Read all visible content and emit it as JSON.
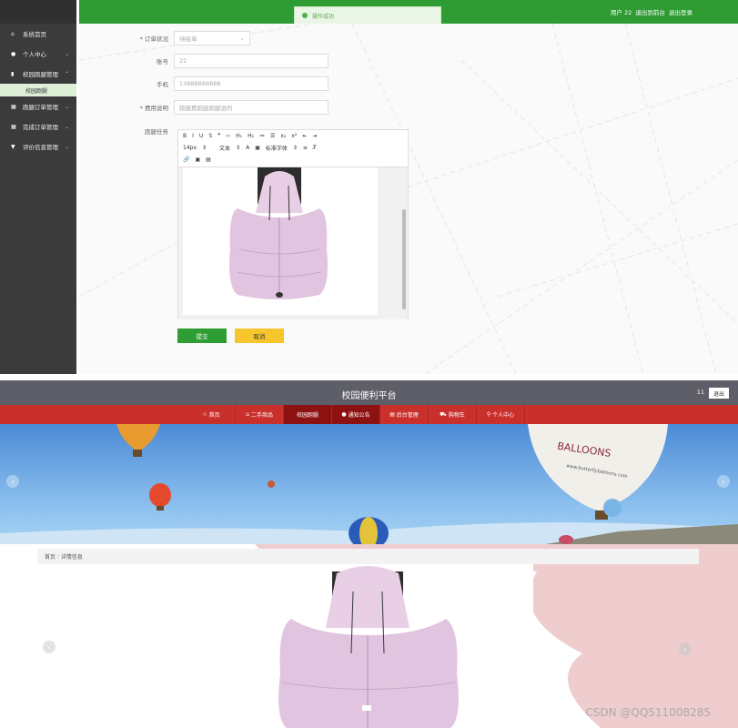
{
  "admin": {
    "sidebar": [
      {
        "icon": "home-icon",
        "label": "系统首页",
        "chevron": false
      },
      {
        "icon": "user-icon",
        "label": "个人中心",
        "chevron": true
      },
      {
        "icon": "chart-icon",
        "label": "校园跑腿管理",
        "chevron": true,
        "expanded": true
      },
      {
        "icon": "grid-icon",
        "label": "跑腿订单管理",
        "chevron": true
      },
      {
        "icon": "grid-icon",
        "label": "完成订单管理",
        "chevron": true
      },
      {
        "icon": "pin-icon",
        "label": "评价信息管理",
        "chevron": true
      }
    ],
    "sub_item": "校园跑腿",
    "header": {
      "user": "用户 22",
      "link1": "退出到前台",
      "link2": "退出登录"
    },
    "toast": "操作成功",
    "form": {
      "status_label": "* 订单状况",
      "status_value": "待接单",
      "account_label": "账号",
      "account_value": "22",
      "phone_label": "手机",
      "phone_value": "13888888888",
      "fee_label": "* 费用说明",
      "fee_value": "跑腿费跑腿跑腿说的",
      "task_label": "跑腿任务",
      "toolbar_row1": [
        "B",
        "I",
        "U",
        "S",
        "❞",
        "‹›",
        "H₁",
        "H₂",
        "≔",
        "☰",
        "x₂",
        "x²",
        "⇤",
        "⇥"
      ],
      "toolbar_row2": [
        "14px",
        "文本",
        "标准字体"
      ],
      "submit": "提交",
      "cancel": "取消"
    }
  },
  "front": {
    "title": "校园便利平台",
    "uid": "11",
    "logout": "退出",
    "nav": [
      {
        "icon": "☆",
        "label": "首页"
      },
      {
        "icon": "⌂",
        "label": "二手商品"
      },
      {
        "icon": "",
        "label": "校园跑腿",
        "active": true
      },
      {
        "icon": "●",
        "label": "通知公告",
        "active": true
      },
      {
        "icon": "▤",
        "label": "后台管理"
      },
      {
        "icon": "🛒",
        "label": "购物车"
      },
      {
        "icon": "⚲",
        "label": "个人中心"
      }
    ],
    "balloon_text": "BALLOONS",
    "balloon_url": "www.butterflyballoons.com",
    "breadcrumb": {
      "home": "首页",
      "sep": ":",
      "current": "详情信息"
    },
    "watermark": "CSDN @QQ511008285"
  }
}
